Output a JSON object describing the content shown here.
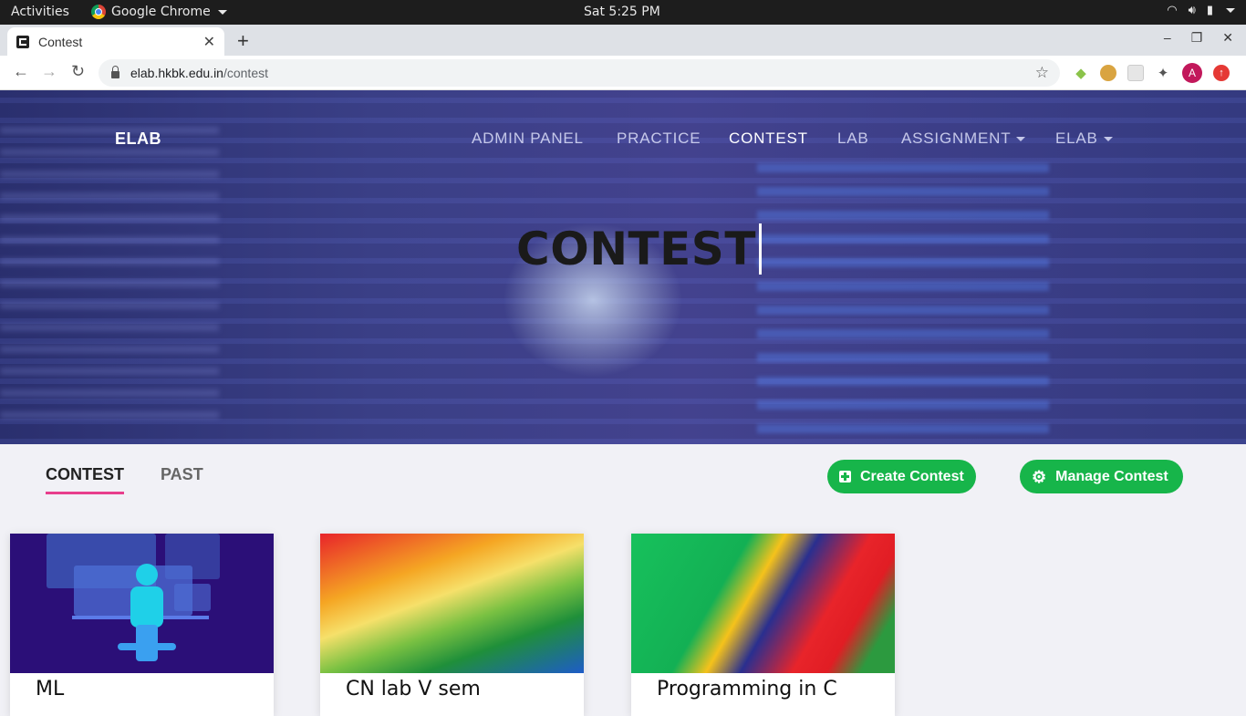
{
  "os": {
    "activities": "Activities",
    "app_name": "Google Chrome",
    "clock": "Sat  5:25 PM"
  },
  "browser": {
    "tab_title": "Contest",
    "url_domain": "elab.hkbk.edu.in",
    "url_path": "/contest",
    "avatar_letter": "A"
  },
  "nav": {
    "brand": "ELAB",
    "items": [
      {
        "label": "ADMIN PANEL"
      },
      {
        "label": "PRACTICE"
      },
      {
        "label": "CONTEST"
      },
      {
        "label": "LAB"
      },
      {
        "label": "ASSIGNMENT"
      },
      {
        "label": "ELAB"
      }
    ]
  },
  "hero": {
    "title": "CONTEST"
  },
  "contest_tabs": [
    {
      "label": "CONTEST"
    },
    {
      "label": "PAST"
    }
  ],
  "buttons": {
    "create": "Create Contest",
    "manage": "Manage Contest"
  },
  "cards": [
    {
      "name": "ML"
    },
    {
      "name": "CN lab V sem"
    },
    {
      "name": "Programming in C"
    }
  ],
  "colors": {
    "accent_green": "#17b54a",
    "tab_underline": "#e83e8c"
  }
}
